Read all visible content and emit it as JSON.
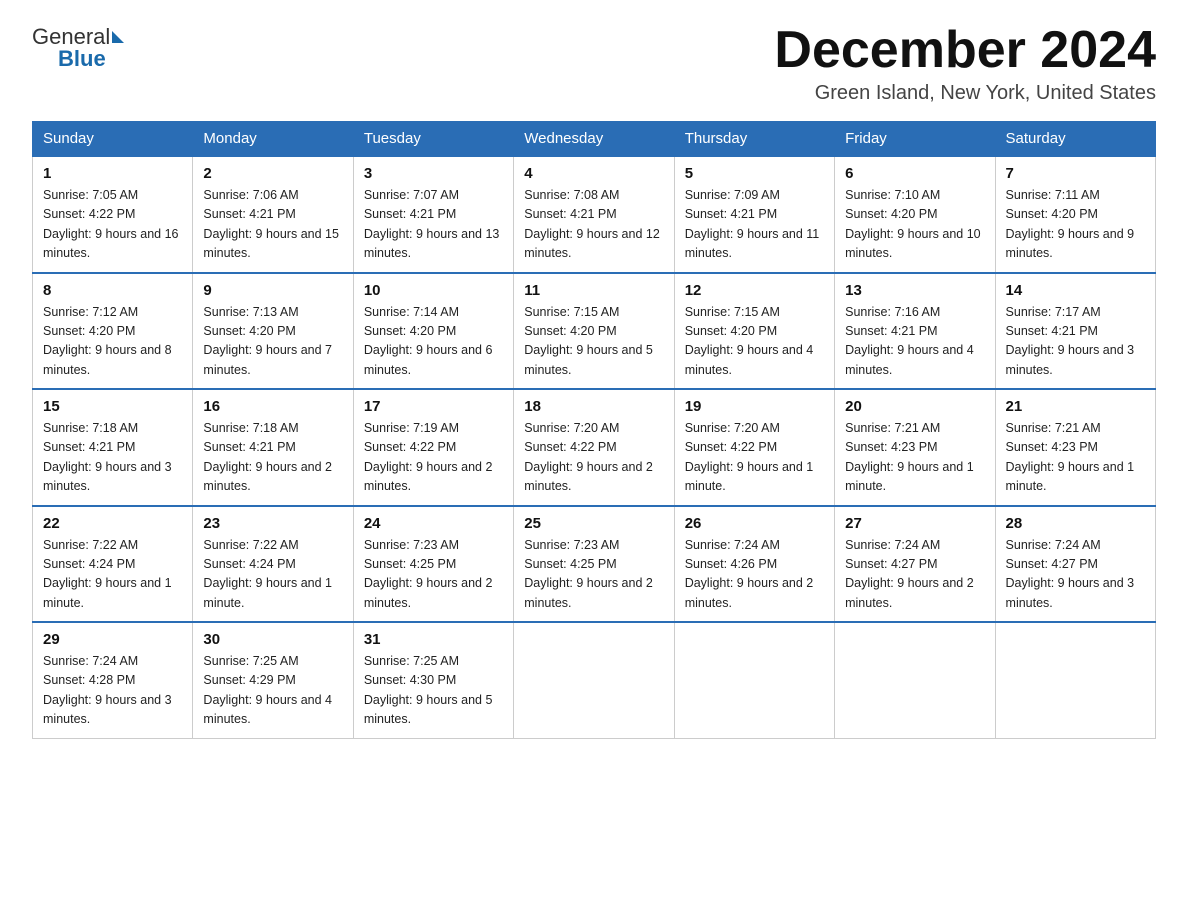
{
  "logo": {
    "general": "General",
    "blue": "Blue"
  },
  "header": {
    "title": "December 2024",
    "subtitle": "Green Island, New York, United States"
  },
  "days_of_week": [
    "Sunday",
    "Monday",
    "Tuesday",
    "Wednesday",
    "Thursday",
    "Friday",
    "Saturday"
  ],
  "weeks": [
    [
      {
        "day": "1",
        "sunrise": "Sunrise: 7:05 AM",
        "sunset": "Sunset: 4:22 PM",
        "daylight": "Daylight: 9 hours and 16 minutes."
      },
      {
        "day": "2",
        "sunrise": "Sunrise: 7:06 AM",
        "sunset": "Sunset: 4:21 PM",
        "daylight": "Daylight: 9 hours and 15 minutes."
      },
      {
        "day": "3",
        "sunrise": "Sunrise: 7:07 AM",
        "sunset": "Sunset: 4:21 PM",
        "daylight": "Daylight: 9 hours and 13 minutes."
      },
      {
        "day": "4",
        "sunrise": "Sunrise: 7:08 AM",
        "sunset": "Sunset: 4:21 PM",
        "daylight": "Daylight: 9 hours and 12 minutes."
      },
      {
        "day": "5",
        "sunrise": "Sunrise: 7:09 AM",
        "sunset": "Sunset: 4:21 PM",
        "daylight": "Daylight: 9 hours and 11 minutes."
      },
      {
        "day": "6",
        "sunrise": "Sunrise: 7:10 AM",
        "sunset": "Sunset: 4:20 PM",
        "daylight": "Daylight: 9 hours and 10 minutes."
      },
      {
        "day": "7",
        "sunrise": "Sunrise: 7:11 AM",
        "sunset": "Sunset: 4:20 PM",
        "daylight": "Daylight: 9 hours and 9 minutes."
      }
    ],
    [
      {
        "day": "8",
        "sunrise": "Sunrise: 7:12 AM",
        "sunset": "Sunset: 4:20 PM",
        "daylight": "Daylight: 9 hours and 8 minutes."
      },
      {
        "day": "9",
        "sunrise": "Sunrise: 7:13 AM",
        "sunset": "Sunset: 4:20 PM",
        "daylight": "Daylight: 9 hours and 7 minutes."
      },
      {
        "day": "10",
        "sunrise": "Sunrise: 7:14 AM",
        "sunset": "Sunset: 4:20 PM",
        "daylight": "Daylight: 9 hours and 6 minutes."
      },
      {
        "day": "11",
        "sunrise": "Sunrise: 7:15 AM",
        "sunset": "Sunset: 4:20 PM",
        "daylight": "Daylight: 9 hours and 5 minutes."
      },
      {
        "day": "12",
        "sunrise": "Sunrise: 7:15 AM",
        "sunset": "Sunset: 4:20 PM",
        "daylight": "Daylight: 9 hours and 4 minutes."
      },
      {
        "day": "13",
        "sunrise": "Sunrise: 7:16 AM",
        "sunset": "Sunset: 4:21 PM",
        "daylight": "Daylight: 9 hours and 4 minutes."
      },
      {
        "day": "14",
        "sunrise": "Sunrise: 7:17 AM",
        "sunset": "Sunset: 4:21 PM",
        "daylight": "Daylight: 9 hours and 3 minutes."
      }
    ],
    [
      {
        "day": "15",
        "sunrise": "Sunrise: 7:18 AM",
        "sunset": "Sunset: 4:21 PM",
        "daylight": "Daylight: 9 hours and 3 minutes."
      },
      {
        "day": "16",
        "sunrise": "Sunrise: 7:18 AM",
        "sunset": "Sunset: 4:21 PM",
        "daylight": "Daylight: 9 hours and 2 minutes."
      },
      {
        "day": "17",
        "sunrise": "Sunrise: 7:19 AM",
        "sunset": "Sunset: 4:22 PM",
        "daylight": "Daylight: 9 hours and 2 minutes."
      },
      {
        "day": "18",
        "sunrise": "Sunrise: 7:20 AM",
        "sunset": "Sunset: 4:22 PM",
        "daylight": "Daylight: 9 hours and 2 minutes."
      },
      {
        "day": "19",
        "sunrise": "Sunrise: 7:20 AM",
        "sunset": "Sunset: 4:22 PM",
        "daylight": "Daylight: 9 hours and 1 minute."
      },
      {
        "day": "20",
        "sunrise": "Sunrise: 7:21 AM",
        "sunset": "Sunset: 4:23 PM",
        "daylight": "Daylight: 9 hours and 1 minute."
      },
      {
        "day": "21",
        "sunrise": "Sunrise: 7:21 AM",
        "sunset": "Sunset: 4:23 PM",
        "daylight": "Daylight: 9 hours and 1 minute."
      }
    ],
    [
      {
        "day": "22",
        "sunrise": "Sunrise: 7:22 AM",
        "sunset": "Sunset: 4:24 PM",
        "daylight": "Daylight: 9 hours and 1 minute."
      },
      {
        "day": "23",
        "sunrise": "Sunrise: 7:22 AM",
        "sunset": "Sunset: 4:24 PM",
        "daylight": "Daylight: 9 hours and 1 minute."
      },
      {
        "day": "24",
        "sunrise": "Sunrise: 7:23 AM",
        "sunset": "Sunset: 4:25 PM",
        "daylight": "Daylight: 9 hours and 2 minutes."
      },
      {
        "day": "25",
        "sunrise": "Sunrise: 7:23 AM",
        "sunset": "Sunset: 4:25 PM",
        "daylight": "Daylight: 9 hours and 2 minutes."
      },
      {
        "day": "26",
        "sunrise": "Sunrise: 7:24 AM",
        "sunset": "Sunset: 4:26 PM",
        "daylight": "Daylight: 9 hours and 2 minutes."
      },
      {
        "day": "27",
        "sunrise": "Sunrise: 7:24 AM",
        "sunset": "Sunset: 4:27 PM",
        "daylight": "Daylight: 9 hours and 2 minutes."
      },
      {
        "day": "28",
        "sunrise": "Sunrise: 7:24 AM",
        "sunset": "Sunset: 4:27 PM",
        "daylight": "Daylight: 9 hours and 3 minutes."
      }
    ],
    [
      {
        "day": "29",
        "sunrise": "Sunrise: 7:24 AM",
        "sunset": "Sunset: 4:28 PM",
        "daylight": "Daylight: 9 hours and 3 minutes."
      },
      {
        "day": "30",
        "sunrise": "Sunrise: 7:25 AM",
        "sunset": "Sunset: 4:29 PM",
        "daylight": "Daylight: 9 hours and 4 minutes."
      },
      {
        "day": "31",
        "sunrise": "Sunrise: 7:25 AM",
        "sunset": "Sunset: 4:30 PM",
        "daylight": "Daylight: 9 hours and 5 minutes."
      },
      null,
      null,
      null,
      null
    ]
  ]
}
